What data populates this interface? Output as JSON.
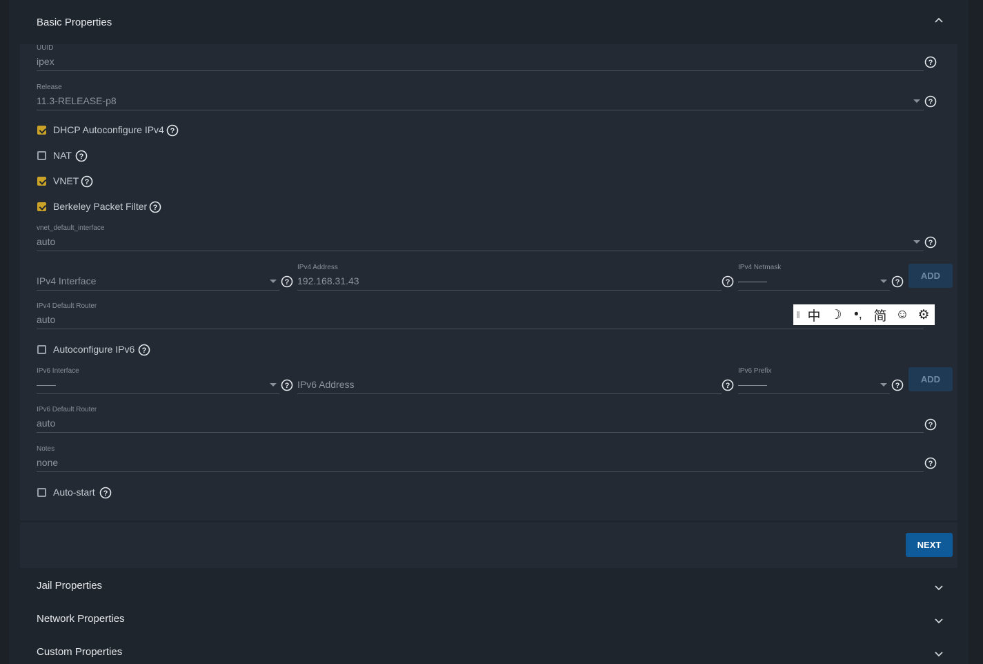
{
  "sections": {
    "basic": {
      "title": "Basic Properties"
    },
    "jail": {
      "title": "Jail Properties"
    },
    "network": {
      "title": "Network Properties"
    },
    "custom": {
      "title": "Custom Properties"
    }
  },
  "fields": {
    "uuid": {
      "label": "UUID",
      "value": "ipex"
    },
    "release": {
      "label": "Release",
      "value": "11.3-RELEASE-p8"
    },
    "vnet_default_interface": {
      "label": "vnet_default_interface",
      "value": "auto"
    },
    "ipv4_interface": {
      "placeholder": "IPv4 Interface"
    },
    "ipv4_address": {
      "label": "IPv4 Address",
      "value": "192.168.31.43"
    },
    "ipv4_netmask": {
      "label": "IPv4 Netmask",
      "value": "———"
    },
    "ipv4_default_router": {
      "label": "IPv4 Default Router",
      "value": "auto"
    },
    "ipv6_interface": {
      "label": "IPv6 Interface",
      "value": "——"
    },
    "ipv6_address": {
      "placeholder": "IPv6 Address"
    },
    "ipv6_prefix": {
      "label": "IPv6 Prefix",
      "value": "———"
    },
    "ipv6_default_router": {
      "label": "IPv6 Default Router",
      "value": "auto"
    },
    "notes": {
      "label": "Notes",
      "value": "none"
    }
  },
  "checkboxes": {
    "dhcp": {
      "label": "DHCP Autoconfigure IPv4",
      "checked": true
    },
    "nat": {
      "label": "NAT",
      "checked": false
    },
    "vnet": {
      "label": "VNET",
      "checked": true
    },
    "bpf": {
      "label": "Berkeley Packet Filter",
      "checked": true
    },
    "auto_ipv6": {
      "label": "Autoconfigure IPv6",
      "checked": false
    },
    "autostart": {
      "label": "Auto-start",
      "checked": false
    }
  },
  "buttons": {
    "add_ipv4": "ADD",
    "add_ipv6": "ADD",
    "next": "NEXT"
  },
  "ime_toolbar": {
    "items": [
      "中",
      "☽",
      "•,",
      "简",
      "☺",
      "⚙"
    ]
  },
  "colors": {
    "accent_checkbox": "#c9a227",
    "primary_button": "#0f5a99",
    "background": "#1f252c"
  }
}
